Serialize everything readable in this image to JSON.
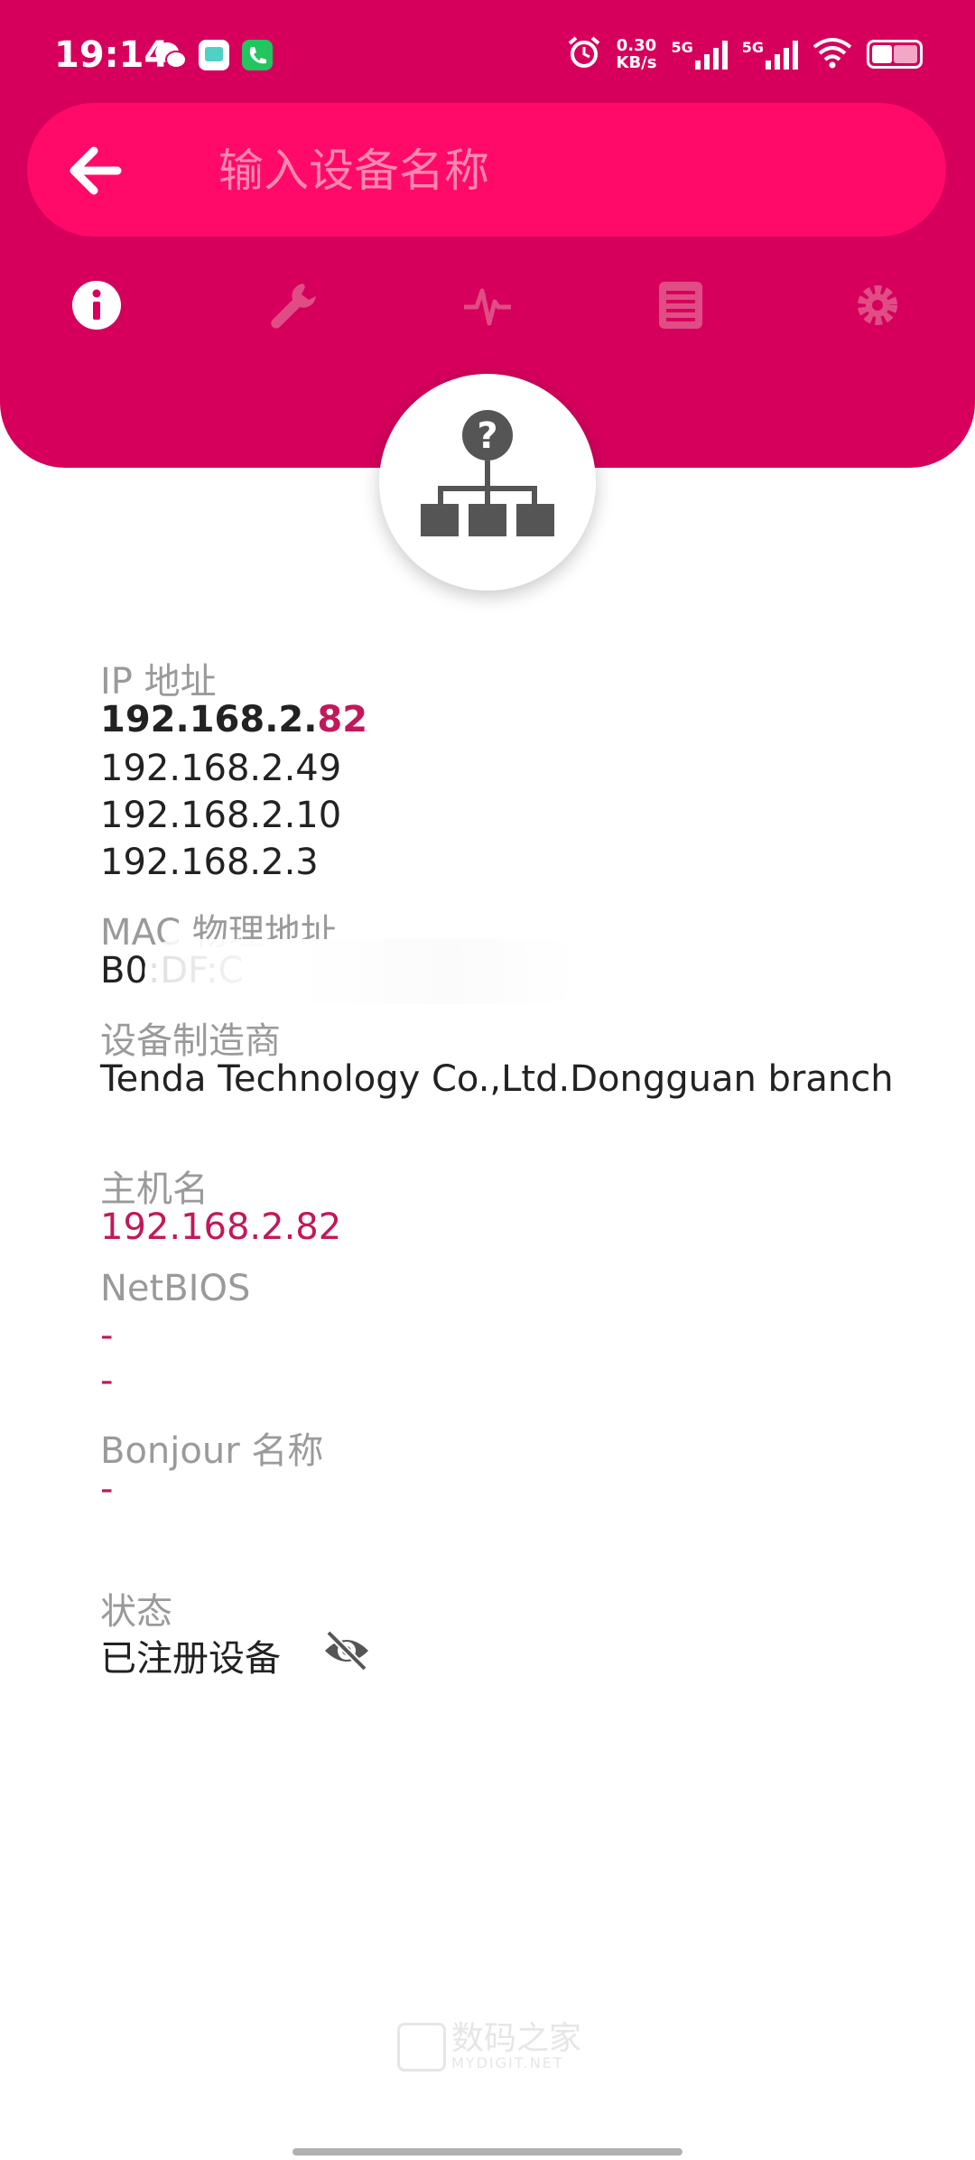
{
  "status_bar": {
    "time": "19:14",
    "net_speed_value": "0.30",
    "net_speed_unit": "KB/s",
    "signal1_label": "5G",
    "signal2_label": "5G",
    "icons": [
      "wechat-icon",
      "notification-icon",
      "phone-icon",
      "alarm-icon",
      "wifi-icon",
      "battery-icon"
    ]
  },
  "search": {
    "placeholder": "输入设备名称",
    "value": ""
  },
  "tabs": [
    {
      "name": "info",
      "icon": "info-icon",
      "active": true
    },
    {
      "name": "tools",
      "icon": "wrench-icon",
      "active": false
    },
    {
      "name": "activity",
      "icon": "pulse-icon",
      "active": false
    },
    {
      "name": "list",
      "icon": "list-icon",
      "active": false
    },
    {
      "name": "settings",
      "icon": "gear-icon",
      "active": false
    }
  ],
  "device_icon": "unknown-network-device-icon",
  "details": {
    "ip_label": "IP 地址",
    "ip_primary_prefix": "192.168.2.",
    "ip_primary_suffix": "82",
    "ip_others": [
      "192.168.2.49",
      "192.168.2.10",
      "192.168.2.3"
    ],
    "mac_label": "MAC 物理地址",
    "mac_value": "B0:DF:C",
    "vendor_label": "设备制造商",
    "vendor_value": "Tenda Technology Co.,Ltd.Dongguan branch",
    "hostname_label": "主机名",
    "hostname_value": "192.168.2.82",
    "netbios_label": "NetBIOS",
    "netbios_values": [
      "-",
      "-"
    ],
    "bonjour_label": "Bonjour 名称",
    "bonjour_value": "-",
    "status_label": "状态",
    "status_value": "已注册设备"
  },
  "watermark": {
    "line1": "数码之家",
    "line2": "MYDIGIT.NET"
  },
  "colors": {
    "header": "#d6005c",
    "search_bar": "#ff0a68",
    "accent": "#c2185b"
  }
}
